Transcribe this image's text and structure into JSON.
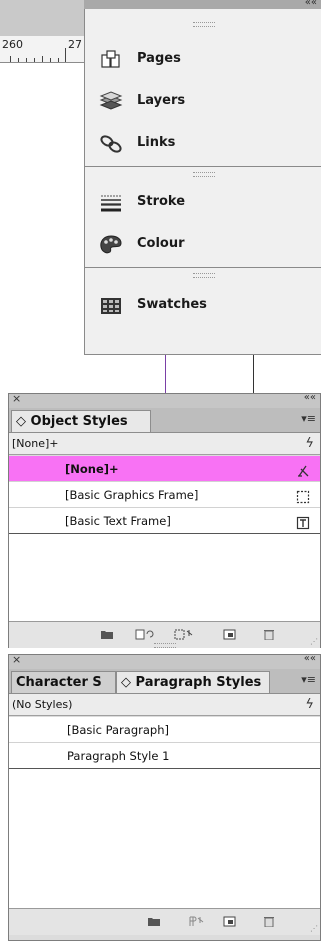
{
  "ruler": {
    "marks": [
      "260",
      "27"
    ]
  },
  "dock": {
    "items": [
      {
        "label": "Pages",
        "icon": "pages-icon"
      },
      {
        "label": "Layers",
        "icon": "layers-icon"
      },
      {
        "label": "Links",
        "icon": "links-icon"
      },
      {
        "label": "Stroke",
        "icon": "stroke-icon"
      },
      {
        "label": "Colour",
        "icon": "colour-icon"
      },
      {
        "label": "Swatches",
        "icon": "swatches-icon"
      }
    ],
    "collapse_glyph": "««"
  },
  "object_styles": {
    "tab": "◇ Object Styles",
    "current": "[None]+",
    "rows": [
      "[None]+",
      "[Basic Graphics Frame]",
      "[Basic Text Frame]"
    ],
    "selected_color": "#f872f4"
  },
  "paragraph_styles": {
    "tab_inactive": "Character S",
    "tab_active": "◇ Paragraph Styles",
    "current": "(No Styles)",
    "rows": [
      "[Basic Paragraph]",
      "Paragraph Style 1"
    ]
  },
  "panel": {
    "close_glyph": "×",
    "collapse_glyph": "««",
    "menu_glyph": "▾≡",
    "bolt_glyph": "ϟ"
  }
}
